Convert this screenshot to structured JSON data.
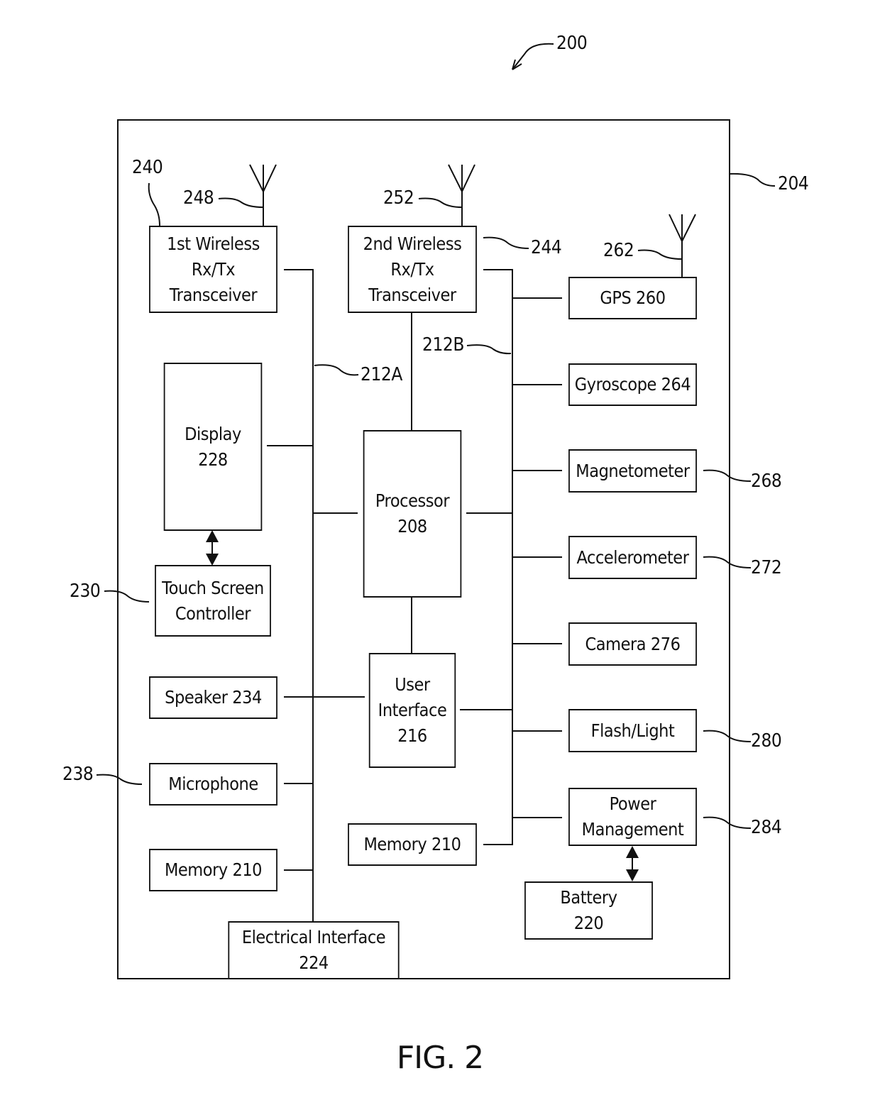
{
  "figure_number": "200",
  "figure_caption": "FIG. 2",
  "housing_ref": "204",
  "blocks": {
    "wireless1": {
      "label": "1st Wireless\nRx/Tx\nTransceiver",
      "ref": "240",
      "antenna_ref": "248"
    },
    "wireless2": {
      "label": "2nd Wireless\nRx/Tx\nTransceiver",
      "ref": "244",
      "antenna_ref": "252"
    },
    "gps": {
      "label": "GPS 260",
      "antenna_ref": "262"
    },
    "display": {
      "label": "Display\n228"
    },
    "touch": {
      "label": "Touch Screen\nController",
      "ref": "230"
    },
    "speaker": {
      "label": "Speaker 234"
    },
    "microphone": {
      "label": "Microphone",
      "ref": "238"
    },
    "memory_left": {
      "label": "Memory 210"
    },
    "electrical": {
      "label": "Electrical Interface\n224"
    },
    "processor": {
      "label": "Processor\n208"
    },
    "user_interface": {
      "label": "User\nInterface\n216"
    },
    "memory_center": {
      "label": "Memory 210"
    },
    "gyroscope": {
      "label": "Gyroscope 264"
    },
    "magnetometer": {
      "label": "Magnetometer",
      "ref": "268"
    },
    "accelerometer": {
      "label": "Accelerometer",
      "ref": "272"
    },
    "camera": {
      "label": "Camera 276"
    },
    "flash": {
      "label": "Flash/Light",
      "ref": "280"
    },
    "power": {
      "label": "Power\nManagement",
      "ref": "284"
    },
    "battery": {
      "label": "Battery\n220"
    }
  },
  "buses": {
    "left": "212A",
    "right": "212B"
  }
}
